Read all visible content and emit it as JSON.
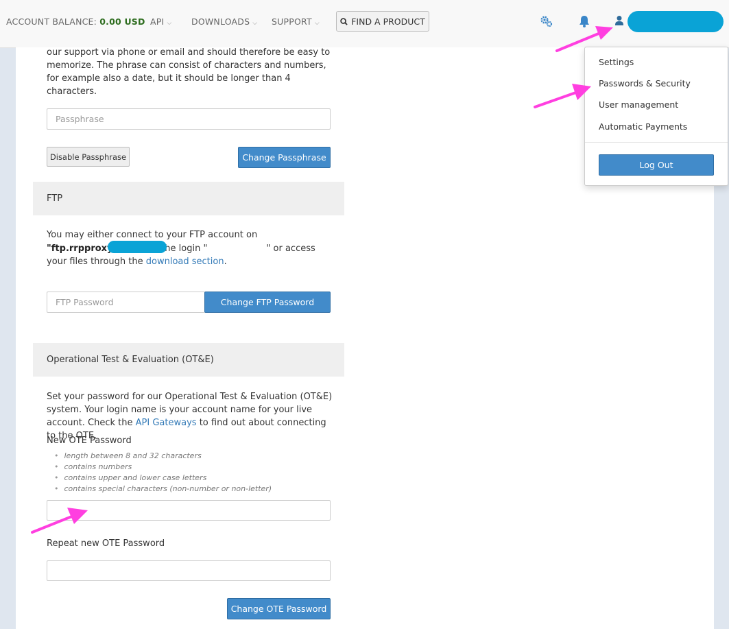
{
  "topbar": {
    "account_balance_label": "ACCOUNT BALANCE:",
    "account_balance_value": "0.00 USD",
    "nav": {
      "api": "API",
      "downloads": "DOWNLOADS",
      "support": "SUPPORT"
    },
    "find_product_label": "FIND A PRODUCT",
    "icons": [
      "search-icon",
      "gears-icon",
      "bell-icon",
      "user-icon",
      "chevron-down-icon"
    ]
  },
  "passphrase": {
    "intro_text": "our support via phone or email and should therefore be easy to memorize. The phrase can consist of characters and numbers, for example also a date, but it should be longer than 4 characters.",
    "input_placeholder": "Passphrase",
    "disable_label": "Disable Passphrase",
    "change_label": "Change Passphrase"
  },
  "ftp": {
    "heading": "FTP",
    "text_before_host": "You may either connect to your FTP account on ",
    "host": "\"ftp.rrpproxy.net\"",
    "text_login_prefix": " with the login \"",
    "text_login_suffix": "\" or access your files through the ",
    "download_link": "download section",
    "text_end": ".",
    "password_placeholder": "FTP Password",
    "change_label": "Change FTP Password"
  },
  "ote": {
    "heading": "Operational Test & Evaluation (OT&E)",
    "text_before_link": "Set your password for our Operational Test & Evaluation (OT&E) system. Your login name is your account name for your live account. Check the ",
    "api_link": "API Gateways",
    "text_after_link": " to find out about connecting to the OTE.",
    "new_password_label": "New OTE Password",
    "requirements": [
      "length between 8 and 32 characters",
      "contains numbers",
      "contains upper and lower case letters",
      "contains special characters (non-number or non-letter)"
    ],
    "repeat_password_label": "Repeat new OTE Password",
    "change_label": "Change OTE Password"
  },
  "user_menu": {
    "items": [
      "Settings",
      "Passwords & Security",
      "User management",
      "Automatic Payments"
    ],
    "logout_label": "Log Out"
  },
  "colors": {
    "primary": "#428bca",
    "balance_green": "#2e6d1f",
    "redaction": "#0aa3d6",
    "annotation_arrow": "#ff3fe0"
  }
}
